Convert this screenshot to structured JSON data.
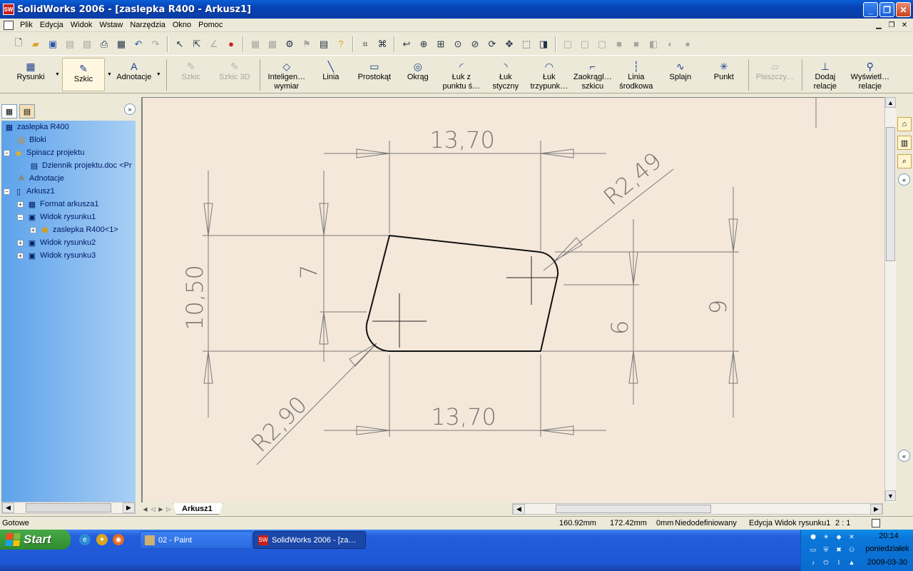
{
  "window": {
    "title": "SolidWorks 2006 - [zaslepka R400 - Arkusz1]",
    "logo_text": "SW"
  },
  "menu": [
    "Plik",
    "Edycja",
    "Widok",
    "Wstaw",
    "Narzędzia",
    "Okno",
    "Pomoc"
  ],
  "command_manager": {
    "rysunki": "Rysunki",
    "szkic": "Szkic",
    "adnotacje": "Adnotacje",
    "tools": [
      {
        "l1": "Szkic",
        "l2": "",
        "icon": "sketch-icon",
        "enabled": false
      },
      {
        "l1": "Szkic 3D",
        "l2": "",
        "icon": "sketch-3d-icon",
        "enabled": false
      },
      {
        "l1": "Inteligen…",
        "l2": "wymiar",
        "icon": "smart-dimension-icon",
        "enabled": true
      },
      {
        "l1": "Linia",
        "l2": "",
        "icon": "line-icon",
        "enabled": true
      },
      {
        "l1": "Prostokąt",
        "l2": "",
        "icon": "rectangle-icon",
        "enabled": true
      },
      {
        "l1": "Okrąg",
        "l2": "",
        "icon": "circle-icon",
        "enabled": true
      },
      {
        "l1": "Łuk z",
        "l2": "punktu ś…",
        "icon": "centerpoint-arc-icon",
        "enabled": true
      },
      {
        "l1": "Łuk",
        "l2": "styczny",
        "icon": "tangent-arc-icon",
        "enabled": true
      },
      {
        "l1": "Łuk",
        "l2": "trzypunk…",
        "icon": "three-point-arc-icon",
        "enabled": true
      },
      {
        "l1": "Zaokrągl…",
        "l2": "szkicu",
        "icon": "sketch-fillet-icon",
        "enabled": true
      },
      {
        "l1": "Linia",
        "l2": "środkowa",
        "icon": "centerline-icon",
        "enabled": true
      },
      {
        "l1": "Splajn",
        "l2": "",
        "icon": "spline-icon",
        "enabled": true
      },
      {
        "l1": "Punkt",
        "l2": "",
        "icon": "point-icon",
        "enabled": true
      },
      {
        "l1": "Płaszczy…",
        "l2": "",
        "icon": "plane-icon",
        "enabled": false
      },
      {
        "l1": "Dodaj",
        "l2": "relacje",
        "icon": "add-relation-icon",
        "enabled": true
      },
      {
        "l1": "Wyświetl…",
        "l2": "relacje",
        "icon": "display-relations-icon",
        "enabled": true
      }
    ]
  },
  "tree": [
    {
      "label": "zaslepka R400",
      "icon": "drawing-icon",
      "expander": ""
    },
    {
      "label": "Bloki",
      "icon": "blocks-folder-icon",
      "expander": ""
    },
    {
      "label": "Spinacz projektu",
      "icon": "design-binder-icon",
      "expander": "−"
    },
    {
      "label": "Dziennik projektu.doc <Pr",
      "icon": "document-icon",
      "expander": ""
    },
    {
      "label": "Adnotacje",
      "icon": "annotations-icon",
      "expander": ""
    },
    {
      "label": "Arkusz1",
      "icon": "sheet-icon",
      "expander": "−"
    },
    {
      "label": "Format arkusza1",
      "icon": "sheet-format-icon",
      "expander": "+"
    },
    {
      "label": "Widok rysunku1",
      "icon": "drawing-view-icon",
      "expander": "−"
    },
    {
      "label": "zaslepka R400<1>",
      "icon": "part-icon",
      "expander": "+"
    },
    {
      "label": "Widok rysunku2",
      "icon": "drawing-view-icon",
      "expander": "+"
    },
    {
      "label": "Widok rysunku3",
      "icon": "drawing-view-icon",
      "expander": "+"
    }
  ],
  "drawing": {
    "dim_top": "13,70",
    "dim_bottom": "13,70",
    "dim_left": "10,50",
    "dim_inner_left": "7",
    "dim_inner_right": "6",
    "dim_right": "9",
    "radius_upper": "R2,49",
    "radius_lower": "R2,90"
  },
  "sheet_tab": "Arkusz1",
  "status": {
    "ready": "Gotowe",
    "x": "160.92mm",
    "y": "172.42mm",
    "z": "0mm",
    "state": "Niedodefiniowany",
    "mode": "Edycja Widok rysunku1",
    "scale": "2 : 1"
  },
  "taskbar": {
    "start": "Start",
    "tasks": [
      {
        "label": "02 - Paint",
        "icon": "paint-icon",
        "active": false
      },
      {
        "label": "SolidWorks 2006 - [za…",
        "icon": "solidworks-icon",
        "active": true
      }
    ],
    "time": "20:14",
    "day": "poniedziałek",
    "date": "2009-03-30"
  },
  "colors": {
    "accent": "#0a5fd8",
    "canvas": "#f4e8da",
    "tree_bg": "#5da2ea"
  }
}
